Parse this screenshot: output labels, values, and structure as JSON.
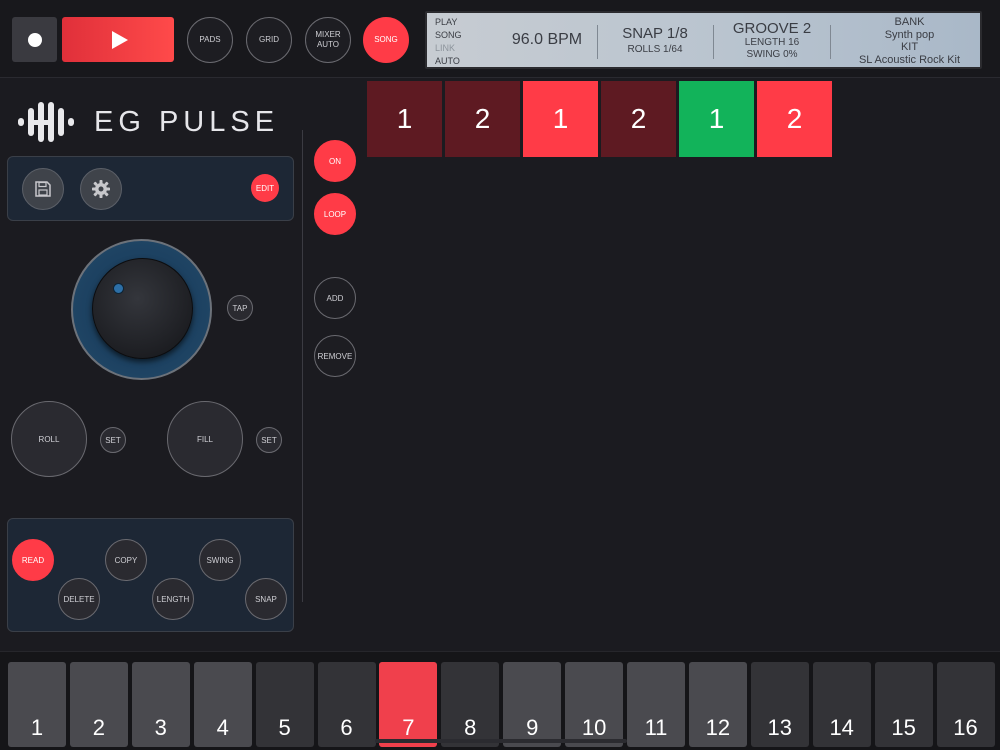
{
  "transport": {
    "record_icon": "record-dot-icon",
    "play_icon": "play-triangle-icon"
  },
  "modes": [
    {
      "label": "PADS",
      "active": false
    },
    {
      "label": "GRID",
      "active": false
    },
    {
      "label": "MIXER\nAUTO",
      "active": false
    },
    {
      "label": "SONG",
      "active": true
    }
  ],
  "lcd": {
    "modes": [
      {
        "label": "PLAY",
        "dim": false
      },
      {
        "label": "SONG",
        "dim": false
      },
      {
        "label": "LINK",
        "dim": true
      },
      {
        "label": "AUTO",
        "dim": false
      }
    ],
    "bpm": "96.0 BPM",
    "snap": "SNAP 1/8",
    "rolls": "ROLLS 1/64",
    "groove": "GROOVE 2",
    "length": "LENGTH 16",
    "swing": "SWING 0%",
    "bank_label": "BANK",
    "bank_value": "Synth pop",
    "kit_label": "KIT",
    "kit_value": "SL Acoustic Rock Kit"
  },
  "logo": {
    "text": "EG PULSE"
  },
  "panel_top": {
    "save_icon": "floppy-disk-icon",
    "settings_icon": "gear-icon",
    "edit_label": "EDIT"
  },
  "tempo": {
    "tap_label": "TAP"
  },
  "roll_fill": {
    "roll_label": "ROLL",
    "roll_set_label": "SET",
    "fill_label": "FILL",
    "fill_set_label": "SET"
  },
  "panel_bottom": {
    "read_label": "READ",
    "copy_label": "COPY",
    "swing_label": "SWING",
    "delete_label": "DELETE",
    "length_label": "LENGTH",
    "snap_label": "SNAP"
  },
  "song_controls": {
    "on_label": "ON",
    "loop_label": "LOOP",
    "add_label": "ADD",
    "remove_label": "REMOVE"
  },
  "song_blocks": [
    {
      "label": "1",
      "color": "#5e1a22"
    },
    {
      "label": "2",
      "color": "#5e1a22"
    },
    {
      "label": "1",
      "color": "#ff3b47"
    },
    {
      "label": "2",
      "color": "#5e1a22"
    },
    {
      "label": "1",
      "color": "#12b35a"
    },
    {
      "label": "2",
      "color": "#ff3b47"
    }
  ],
  "pads": [
    {
      "label": "1",
      "color": "#4a4a4f"
    },
    {
      "label": "2",
      "color": "#4a4a4f"
    },
    {
      "label": "3",
      "color": "#4a4a4f"
    },
    {
      "label": "4",
      "color": "#4a4a4f"
    },
    {
      "label": "5",
      "color": "#333337"
    },
    {
      "label": "6",
      "color": "#333337"
    },
    {
      "label": "7",
      "color": "#f0404c"
    },
    {
      "label": "8",
      "color": "#333337"
    },
    {
      "label": "9",
      "color": "#4a4a4f"
    },
    {
      "label": "10",
      "color": "#4a4a4f"
    },
    {
      "label": "11",
      "color": "#4a4a4f"
    },
    {
      "label": "12",
      "color": "#4a4a4f"
    },
    {
      "label": "13",
      "color": "#333337"
    },
    {
      "label": "14",
      "color": "#333337"
    },
    {
      "label": "15",
      "color": "#333337"
    },
    {
      "label": "16",
      "color": "#333337"
    }
  ]
}
